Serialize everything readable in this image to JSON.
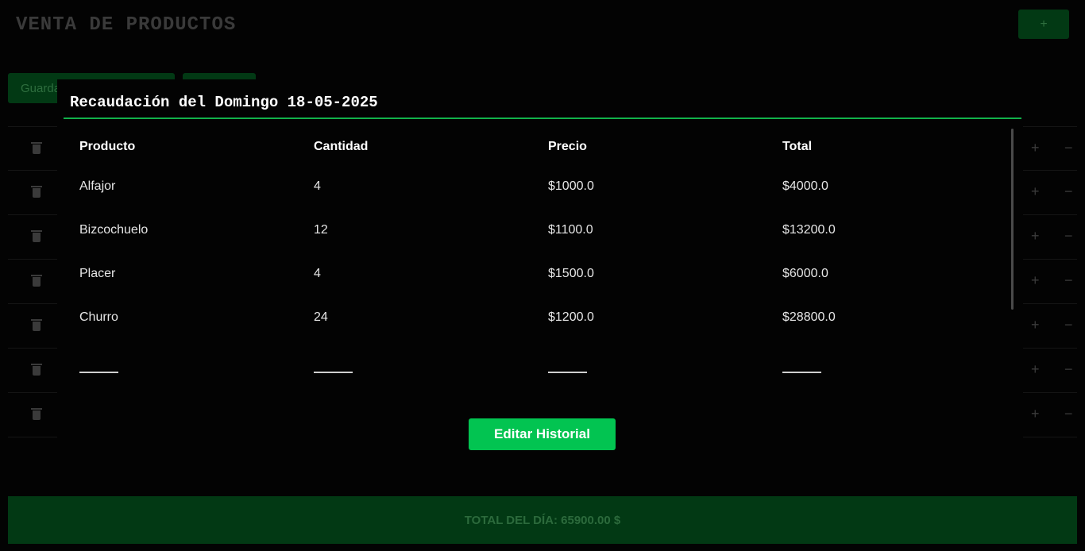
{
  "background": {
    "title": "VENTA DE PRODUCTOS",
    "add_label": "+",
    "save_label": "Guarda",
    "rows": [
      {
        "plus": "+",
        "minus": "−"
      },
      {
        "plus": "+",
        "minus": "−"
      },
      {
        "plus": "+",
        "minus": "−"
      },
      {
        "plus": "+",
        "minus": "−"
      },
      {
        "plus": "+",
        "minus": "−"
      },
      {
        "plus": "+",
        "minus": "−"
      },
      {
        "plus": "+",
        "minus": "−"
      }
    ],
    "total_label": "TOTAL DEL DÍA: 65900.00 $"
  },
  "modal": {
    "title": "Recaudación del Domingo 18-05-2025",
    "columns": [
      "Producto",
      "Cantidad",
      "Precio",
      "Total"
    ],
    "rows": [
      [
        "Alfajor",
        "4",
        "$1000.0",
        "$4000.0"
      ],
      [
        "Bizcochuelo",
        "12",
        "$1100.0",
        "$13200.0"
      ],
      [
        "Placer",
        "4",
        "$1500.0",
        "$6000.0"
      ],
      [
        "Churro",
        "24",
        "$1200.0",
        "$28800.0"
      ]
    ],
    "edit_label": "Editar Historial"
  },
  "colors": {
    "accent": "#02c451",
    "dim_green": "#023914",
    "background": "#030303"
  }
}
